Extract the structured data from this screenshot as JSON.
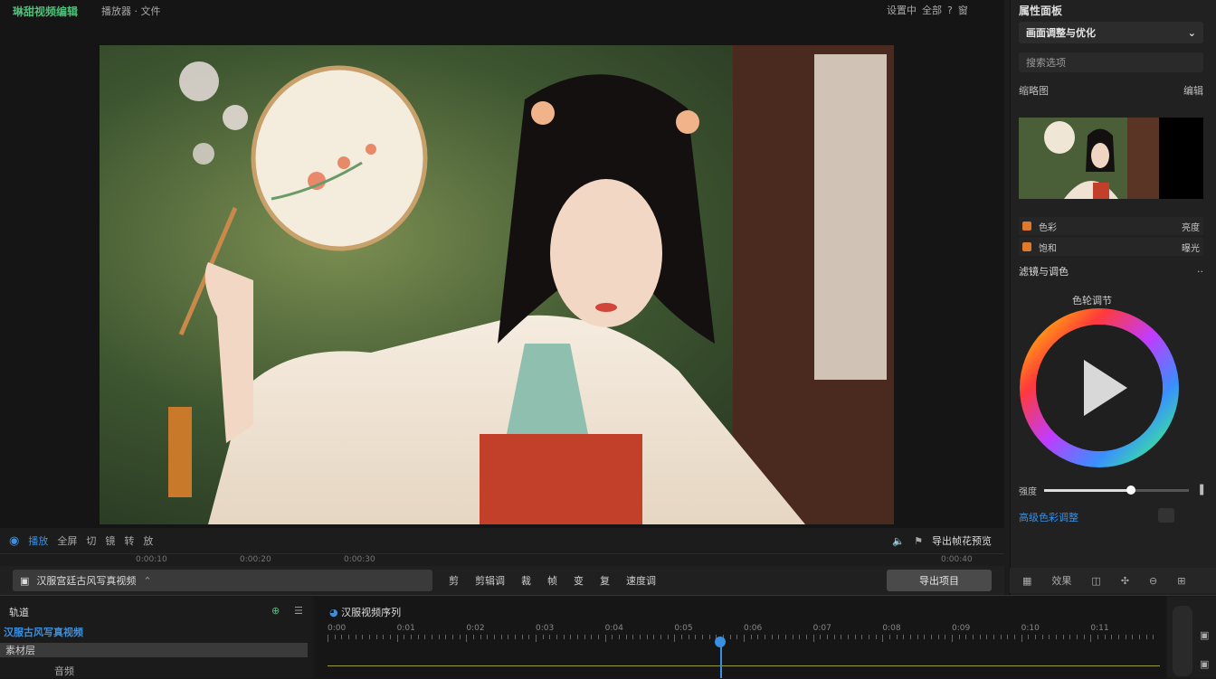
{
  "app": {
    "title": "琳甜视频编辑",
    "document": "播放器 · 文件"
  },
  "top_right": [
    "设置中",
    "全部",
    "?",
    "窗"
  ],
  "viewer": {
    "controls_left": [
      "播放",
      "全屏",
      "切",
      "镜",
      "转",
      "放"
    ],
    "controls_right": [
      "导出帧花预览"
    ],
    "ruler_labels": [
      "0:00:10",
      "0:00:20",
      "0:00:30",
      "0:00:40"
    ]
  },
  "toolbar": {
    "file_label": "汉服宫廷古风写真视频",
    "buttons": [
      "剪",
      "剪辑调",
      "裁",
      "帧",
      "变",
      "复",
      "速度调"
    ],
    "export_label": "导出项目"
  },
  "sidebar": {
    "title": "属性面板",
    "dropdown": "画面调整与优化",
    "search_placeholder": "搜索选项",
    "section_label": "缩略图",
    "section_right": "编辑",
    "props": [
      {
        "label": "色彩",
        "value": "亮度"
      },
      {
        "label": "饱和",
        "value": "曝光"
      }
    ],
    "adjust_title": "滤镜与调色",
    "wheel_label": "色轮调节",
    "slider_label": "强度",
    "slider_value": 0.6,
    "link_text": "高级色彩调整",
    "bottom_label": "效果"
  },
  "timeline": {
    "left_title": "轨道",
    "track_name": "汉服古风写真视频",
    "sub_row": "素材层",
    "row3": "音频",
    "seq_title": "汉服视频序列",
    "ruler": [
      "0:00",
      "0:01",
      "0:02",
      "0:03",
      "0:04",
      "0:05",
      "0:06",
      "0:07",
      "0:08",
      "0:09",
      "0:10",
      "0:11"
    ]
  },
  "colors": {
    "accent_green": "#4fc07a",
    "accent_blue": "#3a8fe0",
    "orange": "#e07a2a"
  }
}
